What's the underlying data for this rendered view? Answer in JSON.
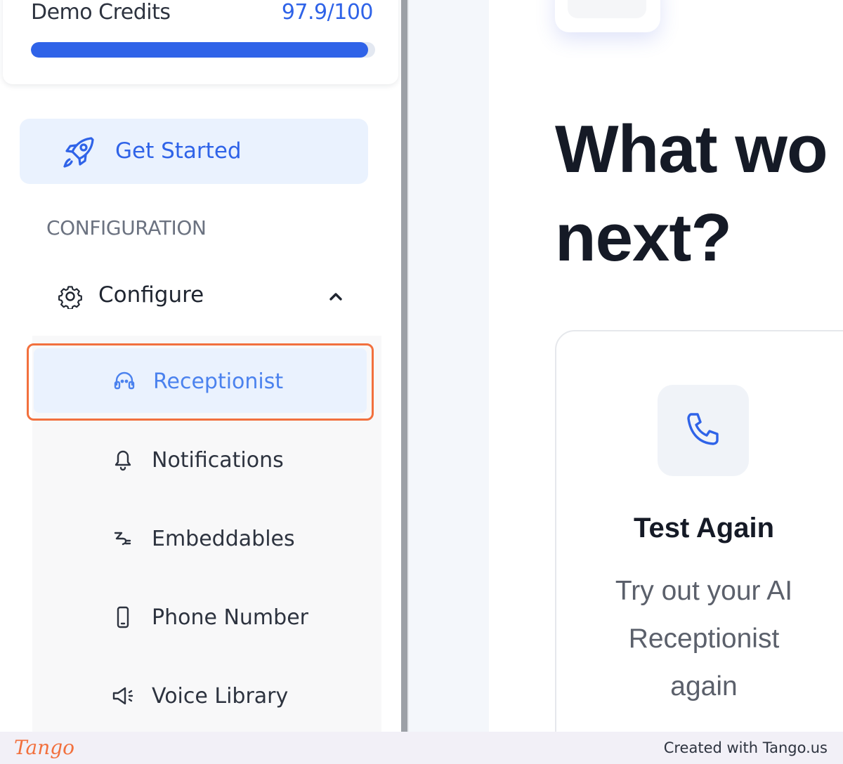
{
  "sidebar": {
    "credits": {
      "label": "Demo Credits",
      "value": "97.9/100",
      "used_fraction": 0.979
    },
    "get_started": {
      "label": "Get Started",
      "icon": "rocket-icon"
    },
    "section_heading": "CONFIGURATION",
    "configure": {
      "label": "Configure",
      "icon": "gear-icon",
      "expanded": true
    },
    "submenu": [
      {
        "label": "Receptionist",
        "icon": "headset-icon",
        "active": true
      },
      {
        "label": "Notifications",
        "icon": "bell-icon",
        "active": false
      },
      {
        "label": "Embeddables",
        "icon": "plug-icon",
        "active": false
      },
      {
        "label": "Phone Number",
        "icon": "smartphone-icon",
        "active": false
      },
      {
        "label": "Voice Library",
        "icon": "speaker-icon",
        "active": false
      }
    ]
  },
  "main": {
    "heading": "What wo\nnext?",
    "action_card": {
      "icon": "phone-icon",
      "title": "Test Again",
      "description": "Try out your AI Receptionist again"
    }
  },
  "footer": {
    "brand": "Tango",
    "credit": "Created with Tango.us"
  },
  "colors": {
    "accent": "#2f63e8",
    "highlight": "#f2703d",
    "active_bg": "#eaf2fe"
  }
}
